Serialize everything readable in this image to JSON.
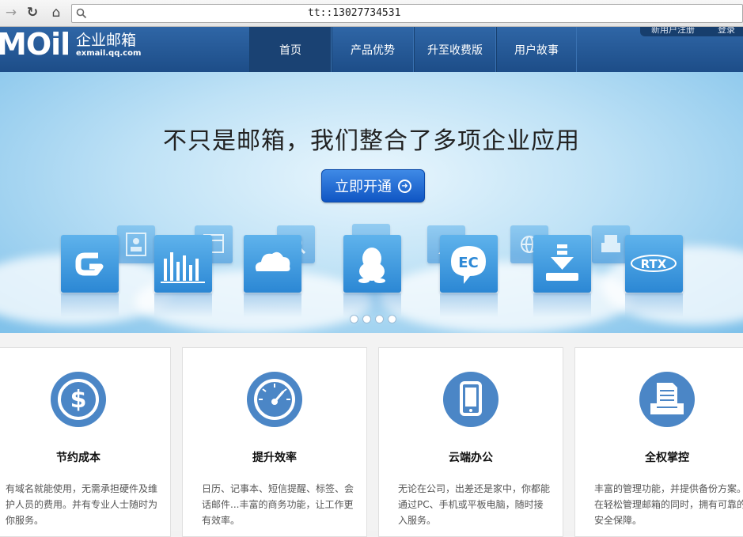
{
  "browser": {
    "address": "tt::13027734531",
    "icons": [
      "back-arrow-icon",
      "reload-icon",
      "home-icon",
      "search-icon"
    ]
  },
  "header": {
    "logo_mark": "MOil",
    "logo_title": "企业邮箱",
    "logo_domain": "exmail.qq.com",
    "nav": [
      {
        "label": "首页",
        "active": true
      },
      {
        "label": "产品优势",
        "active": false
      },
      {
        "label": "升至收费版",
        "active": false
      },
      {
        "label": "用户故事",
        "active": false
      }
    ],
    "register_link": "新用户注册",
    "login_link": "登录"
  },
  "hero": {
    "headline": "不只是邮箱，我们整合了多项企业应用",
    "cta_label": "立即开通",
    "tile_icons": [
      "g-logo-icon",
      "bar-chart-icon",
      "cloud-icon",
      "qq-penguin-icon",
      "ec-chat-icon",
      "download-icon",
      "rtx-icon"
    ],
    "slide_count": 4,
    "accent": "#1d5fc7"
  },
  "features": [
    {
      "icon": "dollar-icon",
      "title": "节约成本",
      "text": "有域名就能使用，无需承担硬件及维护人员的费用。并有专业人士随时为你服务。"
    },
    {
      "icon": "speedometer-icon",
      "title": "提升效率",
      "text": "日历、记事本、短信提醒、标签、会话邮件...丰富的商务功能，让工作更有效率。"
    },
    {
      "icon": "tablet-icon",
      "title": "云端办公",
      "text": "无论在公司，出差还是家中，你都能通过PC、手机或平板电脑，随时接入服务。"
    },
    {
      "icon": "document-tray-icon",
      "title": "全权掌控",
      "text": "丰富的管理功能，并提供备份方案。在轻松管理邮箱的同时，拥有可靠的安全保障。"
    }
  ]
}
